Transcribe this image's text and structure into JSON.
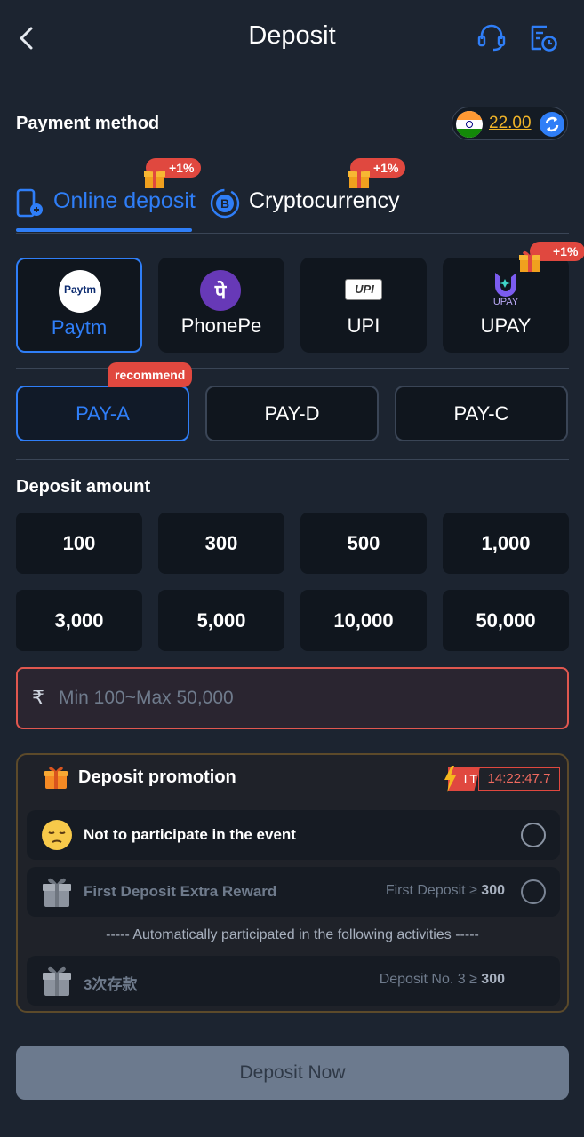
{
  "header": {
    "title": "Deposit",
    "back_icon": "chevron-left-icon",
    "support_icon": "headset-icon",
    "history_icon": "record-history-icon"
  },
  "payment_method": {
    "title": "Payment method",
    "balance": "22.00",
    "flag_icon": "india-flag-icon",
    "refresh_icon": "refresh-icon"
  },
  "tabs": [
    {
      "label": "Online deposit",
      "bonus": "+1%",
      "active": true,
      "icon": "phone-pay-icon"
    },
    {
      "label": "Cryptocurrency",
      "bonus": "+1%",
      "active": false,
      "icon": "bitcoin-icon"
    }
  ],
  "methods": [
    {
      "label": "Paytm",
      "active": true,
      "logo": "paytm-logo",
      "logo_text": "Paytm"
    },
    {
      "label": "PhonePe",
      "active": false,
      "logo": "phonepe-logo",
      "logo_text": "पे"
    },
    {
      "label": "UPI",
      "active": false,
      "logo": "upi-logo",
      "logo_text": "UPI"
    },
    {
      "label": "UPAY",
      "active": false,
      "logo": "upay-logo",
      "logo_text": "UPAY",
      "bonus": "+1%"
    }
  ],
  "channels": {
    "recommend_badge": "recommend",
    "items": [
      {
        "label": "PAY-A",
        "active": true
      },
      {
        "label": "PAY-D",
        "active": false
      },
      {
        "label": "PAY-C",
        "active": false
      }
    ]
  },
  "deposit_amount": {
    "title": "Deposit amount",
    "options": [
      "100",
      "300",
      "500",
      "1,000",
      "3,000",
      "5,000",
      "10,000",
      "50,000"
    ],
    "currency_symbol": "₹",
    "input_placeholder": "Min 100~Max 50,000"
  },
  "promotion": {
    "title": "Deposit promotion",
    "timer_label": "LT",
    "timer": "14:22:47.7",
    "options": [
      {
        "label": "Not to participate in the event",
        "condition": "",
        "icon": "sad-face-icon"
      },
      {
        "label": "First Deposit Extra Reward",
        "condition_prefix": "First Deposit ≥ ",
        "condition_value": "300",
        "icon": "gift-box-icon"
      }
    ],
    "auto_note": "----- Automatically participated in the following activities -----",
    "auto_items": [
      {
        "label": "3次存款",
        "condition_prefix": "Deposit No. 3 ≥ ",
        "condition_value": "300",
        "icon": "gift-box-icon"
      }
    ]
  },
  "submit_label": "Deposit Now",
  "colors": {
    "background": "#1c2430",
    "card": "#10161e",
    "accent_blue": "#2f7ef7",
    "badge_red": "#e0483f",
    "gold": "#f0b429"
  }
}
